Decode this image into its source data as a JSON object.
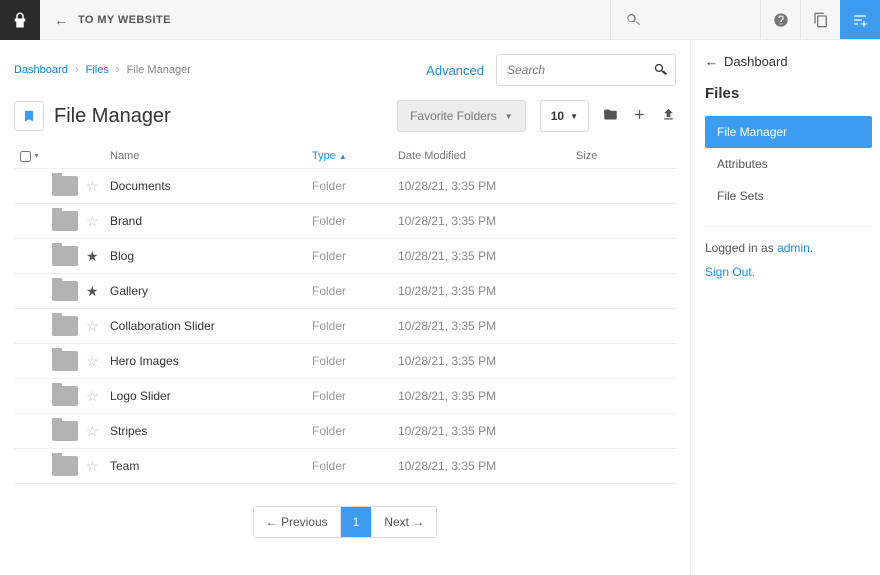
{
  "topbar": {
    "back_label": "TO MY WEBSITE"
  },
  "breadcrumbs": {
    "dashboard": "Dashboard",
    "files": "Files",
    "current": "File Manager"
  },
  "controls": {
    "advanced": "Advanced",
    "search_placeholder": "Search",
    "favorite_folders": "Favorite Folders",
    "per_page": "10"
  },
  "page_title": "File Manager",
  "columns": {
    "name": "Name",
    "type": "Type",
    "date": "Date Modified",
    "size": "Size"
  },
  "rows": [
    {
      "name": "Documents",
      "type": "Folder",
      "date": "10/28/21, 3:35 PM",
      "size": "",
      "starred": false
    },
    {
      "name": "Brand",
      "type": "Folder",
      "date": "10/28/21, 3:35 PM",
      "size": "",
      "starred": false
    },
    {
      "name": "Blog",
      "type": "Folder",
      "date": "10/28/21, 3:35 PM",
      "size": "",
      "starred": true
    },
    {
      "name": "Gallery",
      "type": "Folder",
      "date": "10/28/21, 3:35 PM",
      "size": "",
      "starred": true
    },
    {
      "name": "Collaboration Slider",
      "type": "Folder",
      "date": "10/28/21, 3:35 PM",
      "size": "",
      "starred": false
    },
    {
      "name": "Hero Images",
      "type": "Folder",
      "date": "10/28/21, 3:35 PM",
      "size": "",
      "starred": false
    },
    {
      "name": "Logo Slider",
      "type": "Folder",
      "date": "10/28/21, 3:35 PM",
      "size": "",
      "starred": false
    },
    {
      "name": "Stripes",
      "type": "Folder",
      "date": "10/28/21, 3:35 PM",
      "size": "",
      "starred": false
    },
    {
      "name": "Team",
      "type": "Folder",
      "date": "10/28/21, 3:35 PM",
      "size": "",
      "starred": false
    }
  ],
  "pagination": {
    "prev": "Previous",
    "current": "1",
    "next": "Next"
  },
  "sidebar": {
    "back": "Dashboard",
    "heading": "Files",
    "items": [
      {
        "label": "File Manager",
        "active": true
      },
      {
        "label": "Attributes",
        "active": false
      },
      {
        "label": "File Sets",
        "active": false
      }
    ],
    "logged_in_prefix": "Logged in as ",
    "logged_in_user": "admin",
    "sign_out": "Sign Out."
  }
}
